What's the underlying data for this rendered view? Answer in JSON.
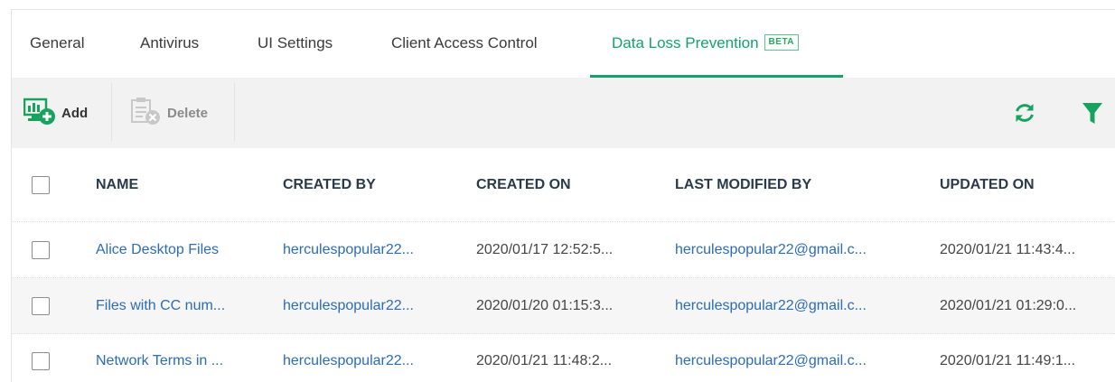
{
  "tabs": [
    {
      "label": "General"
    },
    {
      "label": "Antivirus"
    },
    {
      "label": "UI Settings"
    },
    {
      "label": "Client Access Control"
    },
    {
      "label": "Data Loss Prevention",
      "badge": "BETA",
      "active": true
    }
  ],
  "toolbar": {
    "add_label": "Add",
    "delete_label": "Delete"
  },
  "table": {
    "columns": [
      "NAME",
      "CREATED BY",
      "CREATED ON",
      "LAST MODIFIED BY",
      "UPDATED ON"
    ],
    "rows": [
      {
        "name": "Alice Desktop Files",
        "created_by": "herculespopular22...",
        "created_on": "2020/01/17 12:52:5...",
        "last_modified_by": "herculespopular22@gmail.c...",
        "updated_on": "2020/01/21 11:43:4..."
      },
      {
        "name": "Files with CC num...",
        "created_by": "herculespopular22...",
        "created_on": "2020/01/20 01:15:3...",
        "last_modified_by": "herculespopular22@gmail.c...",
        "updated_on": "2020/01/21 01:29:0..."
      },
      {
        "name": "Network Terms in ...",
        "created_by": "herculespopular22...",
        "created_on": "2020/01/21 11:48:2...",
        "last_modified_by": "herculespopular22@gmail.c...",
        "updated_on": "2020/01/21 11:49:1..."
      }
    ]
  },
  "colors": {
    "accent": "#13a36a",
    "link": "#2b6cb5",
    "toolbar_bg": "#f2f2f2"
  },
  "icons": {
    "add": "add-monitor-icon",
    "delete": "delete-list-icon",
    "refresh": "refresh-icon",
    "filter": "filter-icon"
  }
}
